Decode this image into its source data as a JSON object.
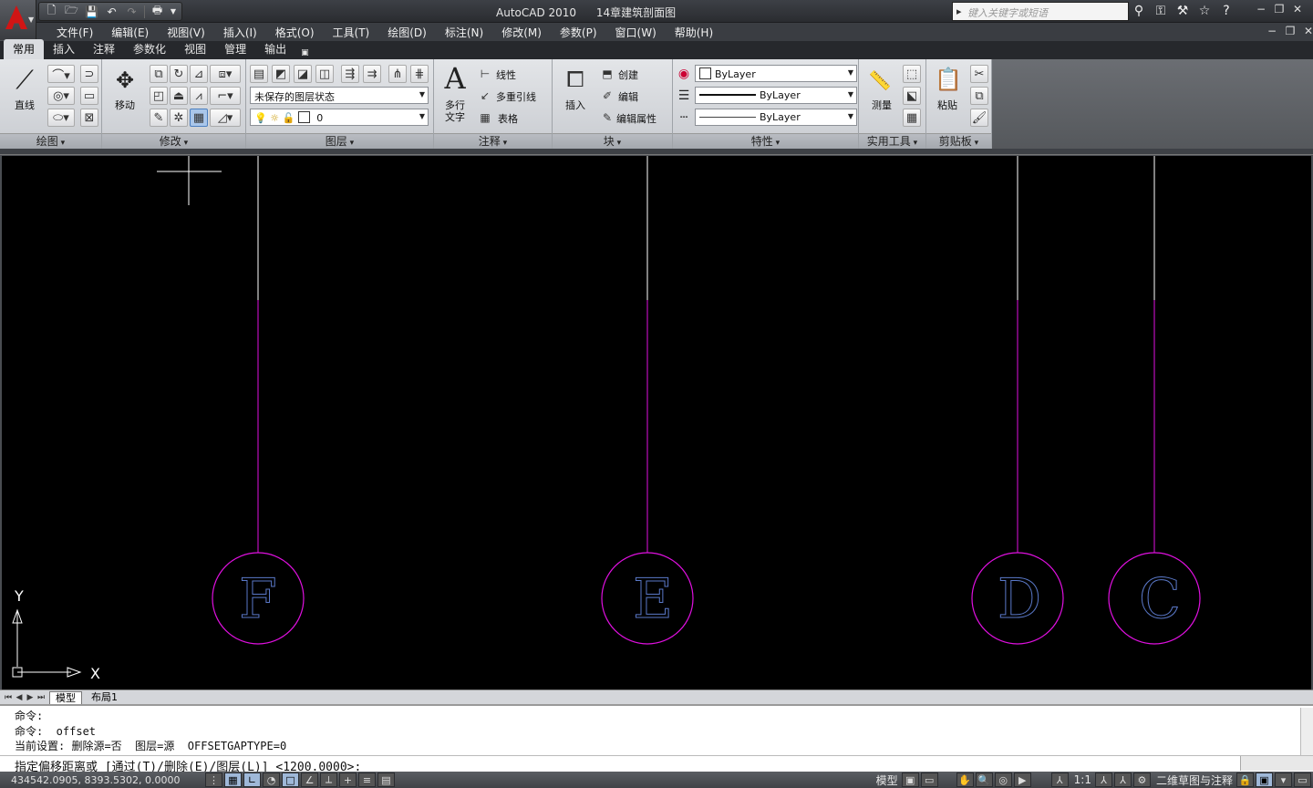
{
  "app": {
    "name": "AutoCAD 2010",
    "document": "14章建筑剖面图"
  },
  "search": {
    "placeholder": "键入关键字或短语"
  },
  "menu": [
    "文件(F)",
    "编辑(E)",
    "视图(V)",
    "插入(I)",
    "格式(O)",
    "工具(T)",
    "绘图(D)",
    "标注(N)",
    "修改(M)",
    "参数(P)",
    "窗口(W)",
    "帮助(H)"
  ],
  "ribbon_tabs": [
    {
      "label": "常用",
      "active": true
    },
    {
      "label": "插入",
      "active": false
    },
    {
      "label": "注释",
      "active": false
    },
    {
      "label": "参数化",
      "active": false
    },
    {
      "label": "视图",
      "active": false
    },
    {
      "label": "管理",
      "active": false
    },
    {
      "label": "输出",
      "active": false
    }
  ],
  "panels": {
    "draw": {
      "title": "绘图",
      "line_label": "直线"
    },
    "modify": {
      "title": "修改",
      "move_label": "移动"
    },
    "layers": {
      "title": "图层",
      "layer_state": "未保存的图层状态",
      "current_layer": "0"
    },
    "annotation": {
      "title": "注释",
      "mtext_label_1": "多行",
      "mtext_label_2": "文字",
      "linear": "线性",
      "multileader": "多重引线",
      "table": "表格"
    },
    "block": {
      "title": "块",
      "insert": "插入",
      "create": "创建",
      "edit": "编辑",
      "edit_attr": "编辑属性"
    },
    "properties": {
      "title": "特性",
      "color": "ByLayer",
      "lineweight": "ByLayer",
      "linetype": "ByLayer"
    },
    "utilities": {
      "title": "实用工具",
      "measure": "测量"
    },
    "clipboard": {
      "title": "剪贴板",
      "paste": "粘贴"
    }
  },
  "drawing": {
    "axis_labels": [
      "F",
      "E",
      "D",
      "C"
    ],
    "ucs": {
      "x": "X",
      "y": "Y"
    }
  },
  "layout_tabs": [
    {
      "label": "模型",
      "active": true
    },
    {
      "label": "布局1",
      "active": false
    }
  ],
  "command": {
    "history": [
      "命令:",
      "命令:  offset",
      "当前设置: 删除源=否  图层=源  OFFSETGAPTYPE=0"
    ],
    "prompt": "指定偏移距离或 [通过(T)/删除(E)/图层(L)] <1200.0000>:"
  },
  "status": {
    "coords": "434542.0905, 8393.5302, 0.0000",
    "model": "模型",
    "scale": "1:1",
    "workspace": "二维草图与注释"
  },
  "colors": {
    "canvas": "#000000",
    "grid_line_upper": "#ffffff",
    "grid_line": "#e010e0",
    "bubble": "#e010e0",
    "bubble_text": "#5a78c8"
  }
}
